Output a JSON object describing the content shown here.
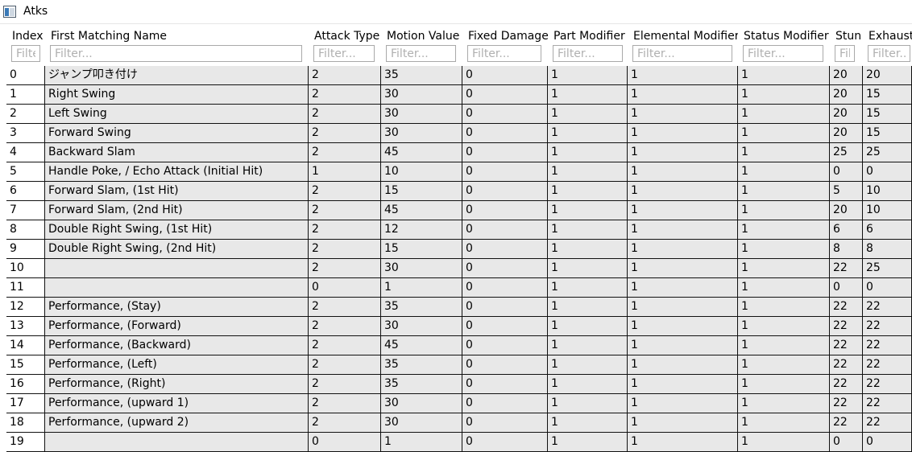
{
  "window": {
    "title": "Atks",
    "icon": "window-icon"
  },
  "columns": [
    {
      "key": "index",
      "label": "Index",
      "filter_placeholder": "Filter..."
    },
    {
      "key": "name",
      "label": "First Matching Name",
      "filter_placeholder": "Filter..."
    },
    {
      "key": "attack_type",
      "label": "Attack Type",
      "filter_placeholder": "Filter..."
    },
    {
      "key": "motion_value",
      "label": "Motion Value",
      "filter_placeholder": "Filter..."
    },
    {
      "key": "fixed_damage",
      "label": "Fixed Damage",
      "filter_placeholder": "Filter..."
    },
    {
      "key": "part_modifier",
      "label": "Part Modifier",
      "filter_placeholder": "Filter..."
    },
    {
      "key": "elemental_modifier",
      "label": "Elemental Modifier",
      "filter_placeholder": "Filter..."
    },
    {
      "key": "status_modifier",
      "label": "Status Modifier",
      "filter_placeholder": "Filter..."
    },
    {
      "key": "stun",
      "label": "Stun",
      "filter_placeholder": "Filter..."
    },
    {
      "key": "exhaust",
      "label": "Exhaust",
      "filter_placeholder": "Filter..."
    }
  ],
  "rows": [
    [
      "0",
      "ジャンプ叩き付け",
      "2",
      "35",
      "0",
      "1",
      "1",
      "1",
      "20",
      "20"
    ],
    [
      "1",
      "Right Swing",
      "2",
      "30",
      "0",
      "1",
      "1",
      "1",
      "20",
      "15"
    ],
    [
      "2",
      "Left Swing",
      "2",
      "30",
      "0",
      "1",
      "1",
      "1",
      "20",
      "15"
    ],
    [
      "3",
      "Forward Swing",
      "2",
      "30",
      "0",
      "1",
      "1",
      "1",
      "20",
      "15"
    ],
    [
      "4",
      "Backward Slam",
      "2",
      "45",
      "0",
      "1",
      "1",
      "1",
      "25",
      "25"
    ],
    [
      "5",
      "Handle Poke, / Echo Attack (Initial Hit)",
      "1",
      "10",
      "0",
      "1",
      "1",
      "1",
      "0",
      "0"
    ],
    [
      "6",
      "Forward Slam, (1st Hit)",
      "2",
      "15",
      "0",
      "1",
      "1",
      "1",
      "5",
      "10"
    ],
    [
      "7",
      "Forward Slam, (2nd Hit)",
      "2",
      "45",
      "0",
      "1",
      "1",
      "1",
      "20",
      "10"
    ],
    [
      "8",
      "Double Right Swing, (1st Hit)",
      "2",
      "12",
      "0",
      "1",
      "1",
      "1",
      "6",
      "6"
    ],
    [
      "9",
      "Double Right Swing, (2nd Hit)",
      "2",
      "15",
      "0",
      "1",
      "1",
      "1",
      "8",
      "8"
    ],
    [
      "10",
      "",
      "2",
      "30",
      "0",
      "1",
      "1",
      "1",
      "22",
      "25"
    ],
    [
      "11",
      "",
      "0",
      "1",
      "0",
      "1",
      "1",
      "1",
      "0",
      "0"
    ],
    [
      "12",
      "Performance, (Stay)",
      "2",
      "35",
      "0",
      "1",
      "1",
      "1",
      "22",
      "22"
    ],
    [
      "13",
      "Performance, (Forward)",
      "2",
      "30",
      "0",
      "1",
      "1",
      "1",
      "22",
      "22"
    ],
    [
      "14",
      "Performance, (Backward)",
      "2",
      "45",
      "0",
      "1",
      "1",
      "1",
      "22",
      "22"
    ],
    [
      "15",
      "Performance, (Left)",
      "2",
      "35",
      "0",
      "1",
      "1",
      "1",
      "22",
      "22"
    ],
    [
      "16",
      "Performance, (Right)",
      "2",
      "35",
      "0",
      "1",
      "1",
      "1",
      "22",
      "22"
    ],
    [
      "17",
      "Performance, (upward 1)",
      "2",
      "30",
      "0",
      "1",
      "1",
      "1",
      "22",
      "22"
    ],
    [
      "18",
      "Performance, (upward 2)",
      "2",
      "30",
      "0",
      "1",
      "1",
      "1",
      "22",
      "22"
    ],
    [
      "19",
      "",
      "0",
      "1",
      "0",
      "1",
      "1",
      "1",
      "0",
      "0"
    ]
  ]
}
